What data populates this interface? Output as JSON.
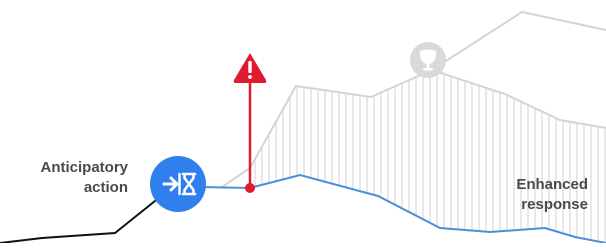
{
  "labels": {
    "anticipatory": [
      "Anticipatory",
      "action"
    ],
    "enhanced": [
      "Enhanced",
      "response"
    ]
  },
  "icons": {
    "action_icon": "arrow-to-hourglass-icon",
    "warning_icon": "warning-triangle-icon",
    "faded_icon": "faded-trophy-icon"
  },
  "colors": {
    "action_blue": "#2f80ed",
    "response_line": "#4a90d9",
    "warning_red": "#e01b2f",
    "grey_line": "#d4d4d4",
    "hatch_grey": "#d9d9d9",
    "baseline_black": "#111111",
    "label_text": "#4a4a4a"
  }
}
